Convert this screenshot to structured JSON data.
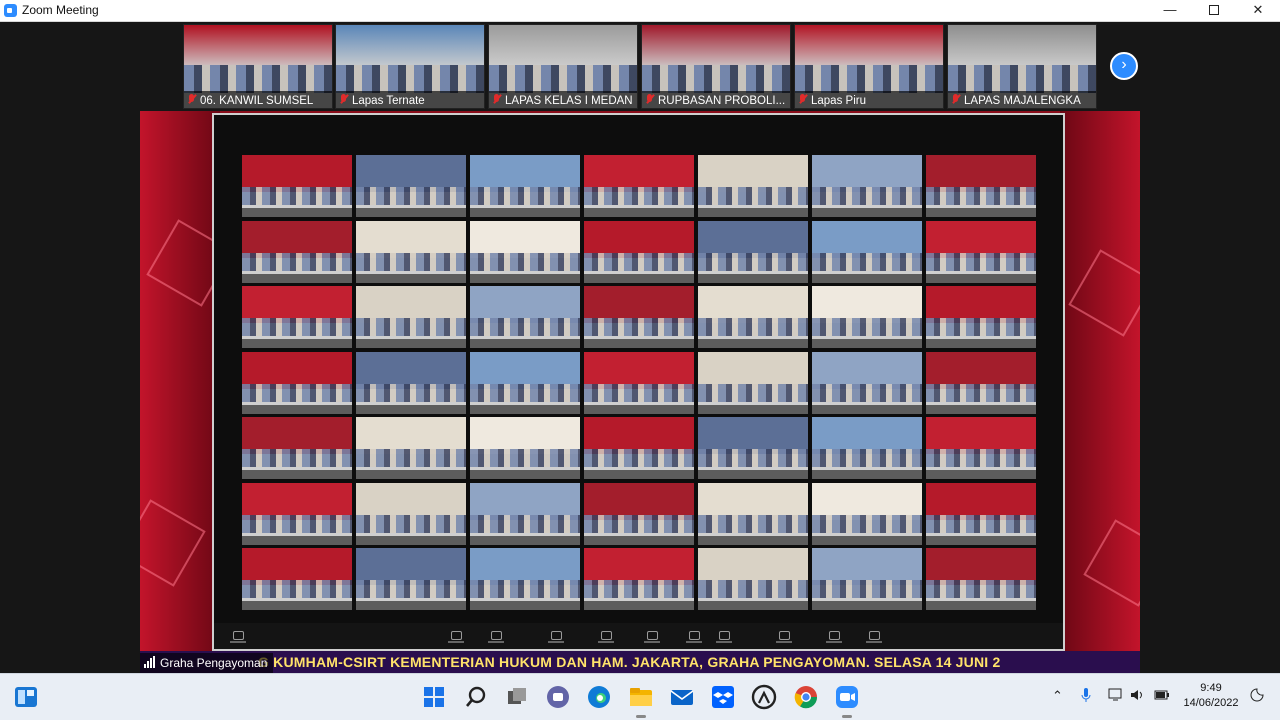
{
  "window": {
    "title": "Zoom Meeting"
  },
  "gallery_strip": {
    "thumbnails": [
      {
        "name": "06. KANWIL SUMSEL",
        "theme": "#b01020"
      },
      {
        "name": "Lapas Ternate",
        "theme": "#5a86b8"
      },
      {
        "name": "LAPAS KELAS I MEDAN",
        "theme": "#9b9b9b"
      },
      {
        "name": "RUPBASAN PROBOLI...",
        "theme": "#a0182a"
      },
      {
        "name": "Lapas Piru",
        "theme": "#b21424"
      },
      {
        "name": "LAPAS MAJALENGKA",
        "theme": "#8e8e8e"
      }
    ],
    "next_page_icon": "chevron-right-icon"
  },
  "stage": {
    "speaker_name": "Graha Pengayoman",
    "ticker_text": "G KUMHAM-CSIRT KEMENTERIAN HUKUM DAN HAM. JAKARTA, GRAHA PENGAYOMAN. SELASA 14 JUNI 2",
    "shared_screen": {
      "grid_rows": 7,
      "grid_cols": 7
    }
  },
  "taskbar": {
    "apps": [
      {
        "icon": "windows-start-icon",
        "color": "#1a73e8"
      },
      {
        "icon": "search-icon",
        "color": "#222222"
      },
      {
        "icon": "task-view-icon",
        "color": "#444444"
      },
      {
        "icon": "teams-chat-icon",
        "color": "#6264a7"
      },
      {
        "icon": "edge-icon",
        "color": "#0f7bd6"
      },
      {
        "icon": "file-explorer-icon",
        "color": "#f4b400"
      },
      {
        "icon": "mail-icon",
        "color": "#0a64c8"
      },
      {
        "icon": "dropbox-icon",
        "color": "#0061fe"
      },
      {
        "icon": "github-desktop-icon",
        "color": "#222222"
      },
      {
        "icon": "chrome-icon",
        "color": "#db4437"
      },
      {
        "icon": "zoom-icon",
        "color": "#2d8cff"
      }
    ],
    "clock_time": "9:49",
    "clock_date": "14/06/2022"
  }
}
